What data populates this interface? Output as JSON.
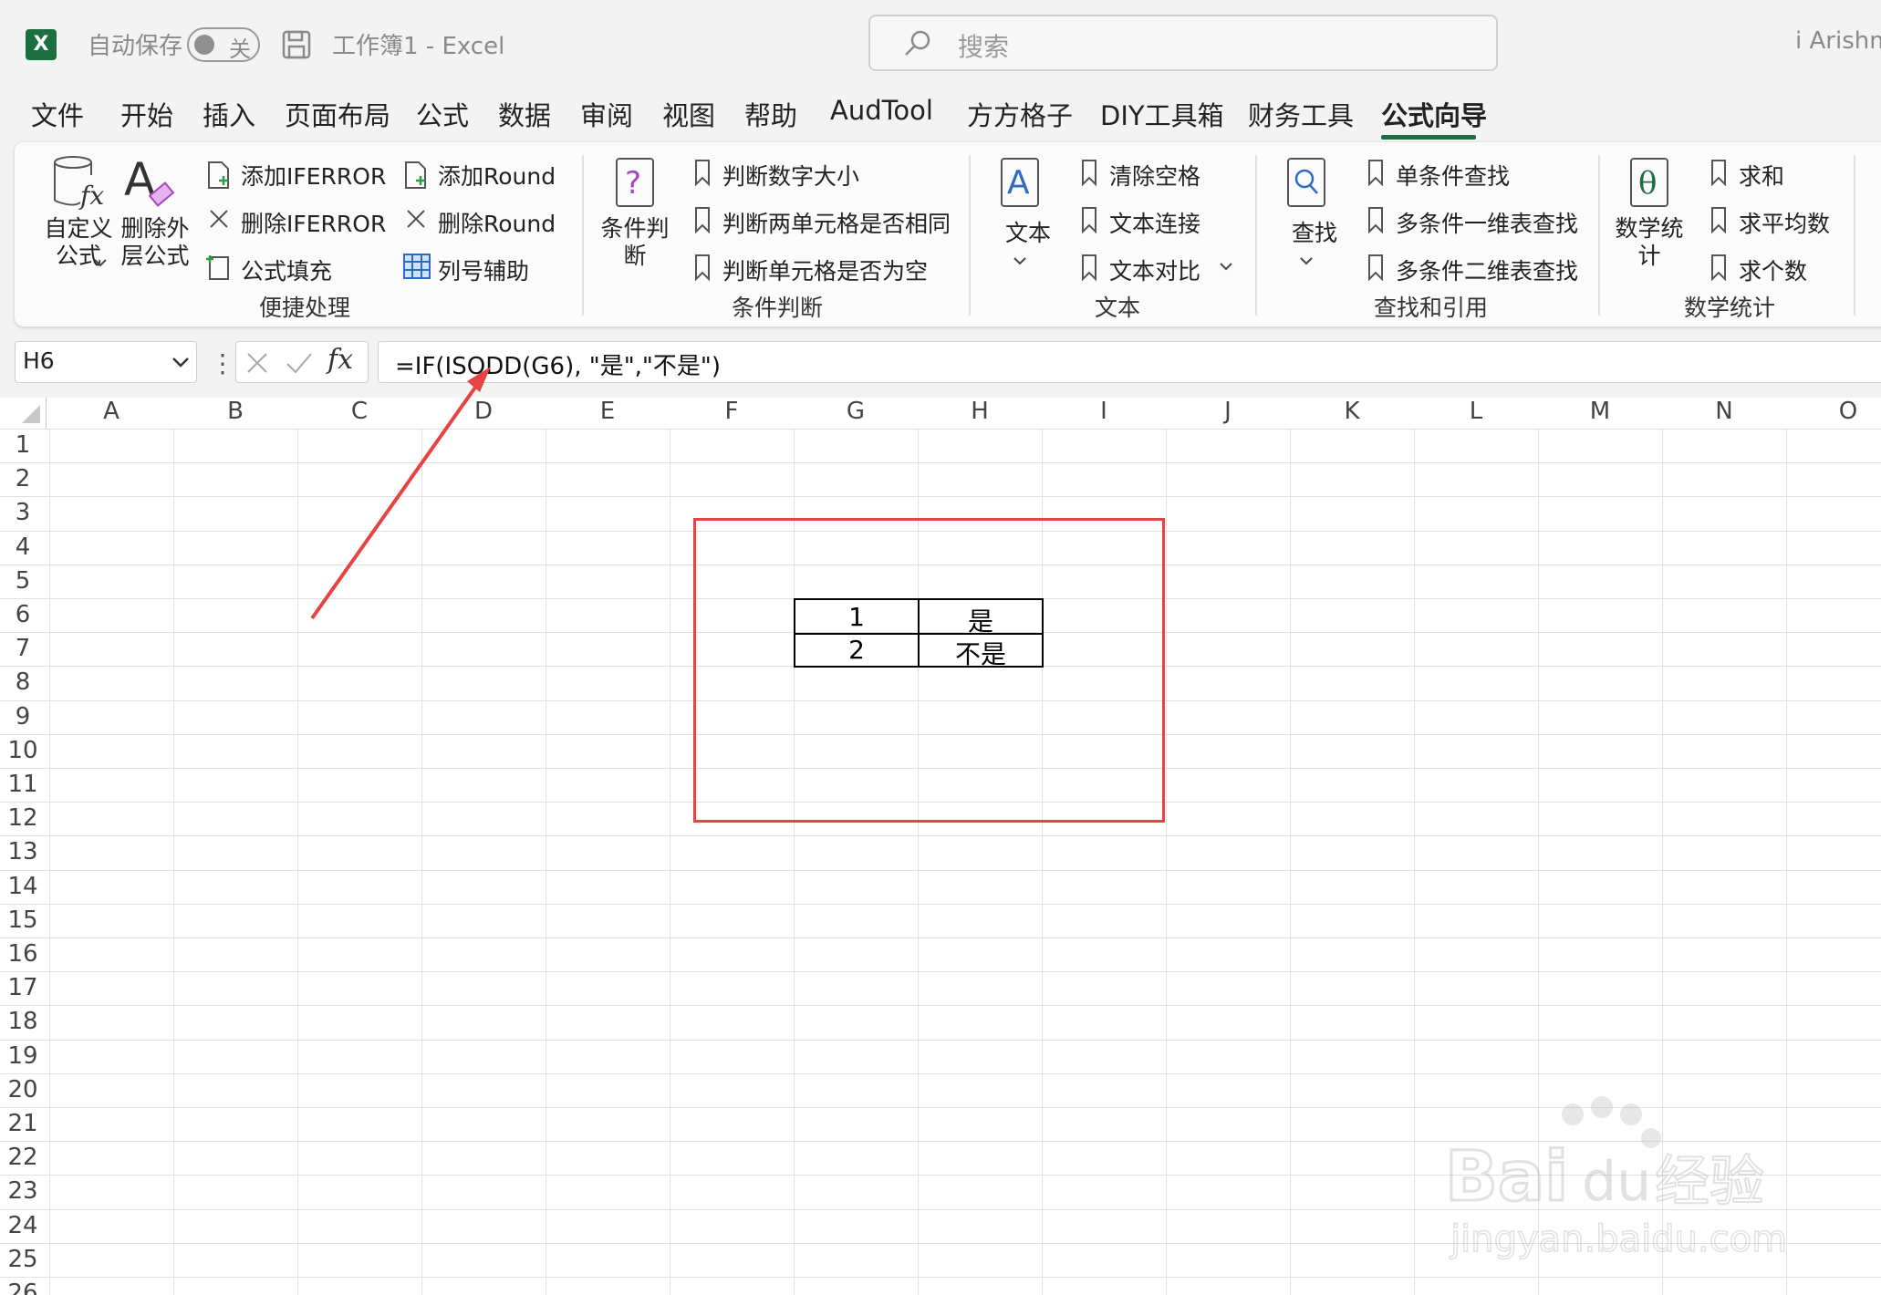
{
  "titlebar": {
    "autosave_label": "自动保存",
    "autosave_state": "关",
    "doc_title": "工作簿1  -  Excel",
    "search_placeholder": "搜索",
    "user_name": "i Arishm"
  },
  "tabs": [
    "文件",
    "开始",
    "插入",
    "页面布局",
    "公式",
    "数据",
    "审阅",
    "视图",
    "帮助",
    "AudTool",
    "方方格子",
    "DIY工具箱",
    "财务工具",
    "公式向导"
  ],
  "active_tab": "公式向导",
  "ribbon": {
    "custom_formula_label": "自定义公式",
    "delete_outer_label": "删除外层公式",
    "quick": {
      "add_iferror": "添加IFERROR",
      "delete_iferror": "删除IFERROR",
      "formula_fill": "公式填充",
      "add_round": "添加Round",
      "delete_round": "删除Round",
      "column_helper": "列号辅助",
      "group_label": "便捷处理"
    },
    "condition": {
      "big_label": "条件判断",
      "items": [
        "判断数字大小",
        "判断两单元格是否相同",
        "判断单元格是否为空"
      ],
      "group_label": "条件判断"
    },
    "text": {
      "big_label": "文本",
      "items": [
        "清除空格",
        "文本连接",
        "文本对比"
      ],
      "group_label": "文本"
    },
    "lookup": {
      "big_label": "查找",
      "items": [
        "单条件查找",
        "多条件一维表查找",
        "多条件二维表查找"
      ],
      "group_label": "查找和引用"
    },
    "stats": {
      "big_label": "数学统计",
      "items": [
        "求和",
        "求平均数",
        "求个数"
      ],
      "group_label": "数学统计"
    }
  },
  "formula_bar": {
    "name_box": "H6",
    "fx": "fx",
    "formula": "=IF(ISODD(G6), \"是\",\"不是\")"
  },
  "grid": {
    "columns": [
      "A",
      "B",
      "C",
      "D",
      "E",
      "F",
      "G",
      "H",
      "I",
      "J",
      "K",
      "L",
      "M",
      "N",
      "O"
    ],
    "rows": [
      "1",
      "2",
      "3",
      "4",
      "5",
      "6",
      "7",
      "8",
      "9",
      "10",
      "11",
      "12",
      "13",
      "14",
      "15",
      "16",
      "17",
      "18",
      "19",
      "20",
      "21",
      "22",
      "23",
      "24",
      "25",
      "26"
    ],
    "cells": {
      "G6": "1",
      "H6": "是",
      "G7": "2",
      "H7": "不是"
    }
  },
  "watermark": {
    "brand": "Bai du 经验",
    "url": "jingyan.baidu.com"
  },
  "colors": {
    "excel_green": "#1d6f42",
    "annotation_red": "#e84343"
  }
}
